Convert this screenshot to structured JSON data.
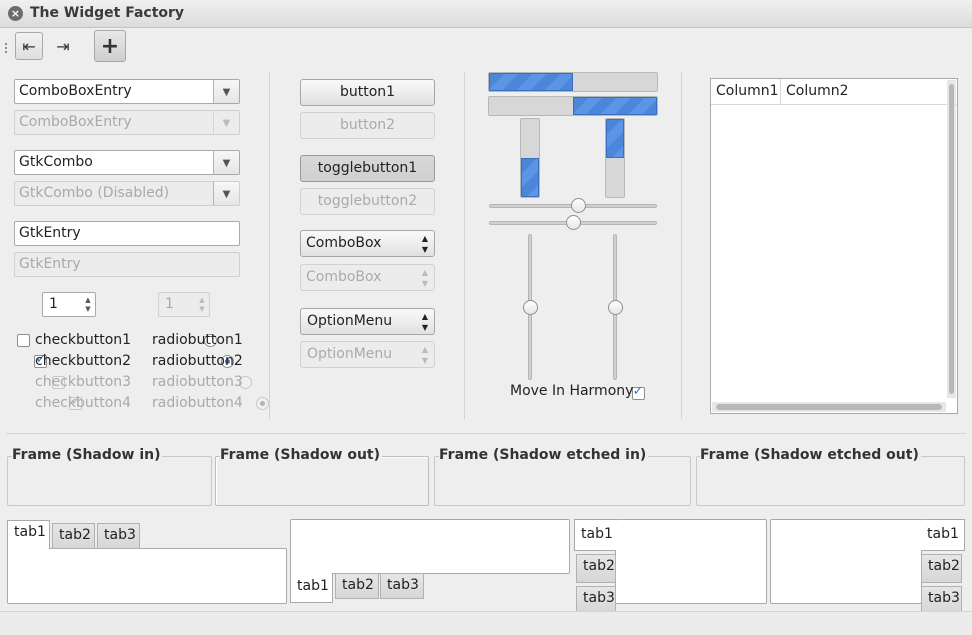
{
  "window": {
    "title": "The Widget Factory"
  },
  "toolbar": {
    "buttons": [
      {
        "icon": "go-first-icon",
        "glyph": "⇤"
      },
      {
        "icon": "go-last-icon",
        "glyph": "⇥"
      },
      {
        "icon": "add-icon",
        "glyph": "+"
      }
    ]
  },
  "col1": {
    "combobox_entry": "ComboBoxEntry",
    "combobox_entry_disabled": "ComboBoxEntry",
    "gtkcombo": "GtkCombo",
    "gtkcombo_disabled": "GtkCombo (Disabled)",
    "entry": "GtkEntry",
    "entry_disabled": "GtkEntry",
    "spin_value": "1",
    "spin_disabled_value": "1",
    "checks": [
      "checkbutton1",
      "checkbutton2",
      "checkbutton3",
      "checkbutton4"
    ],
    "radios": [
      "radiobutton1",
      "radiobutton2",
      "radiobutton3",
      "radiobutton4"
    ]
  },
  "col2": {
    "button1": "button1",
    "button2": "button2",
    "toggle1": "togglebutton1",
    "toggle2": "togglebutton2",
    "combobox": "ComboBox",
    "combobox_disabled": "ComboBox",
    "optionmenu": "OptionMenu",
    "optionmenu_disabled": "OptionMenu"
  },
  "col3": {
    "progress_h1": 0.5,
    "progress_h2": 0.5,
    "progress_v1": 0.5,
    "progress_v2": 0.5,
    "hscale1": 0.5,
    "hscale2": 0.5,
    "vscale1": 0.5,
    "vscale2": 0.5,
    "move_in_harmony": "Move In Harmony"
  },
  "tree": {
    "columns": [
      "Column1",
      "Column2"
    ]
  },
  "frames": [
    "Frame (Shadow in)",
    "Frame (Shadow out)",
    "Frame (Shadow etched in)",
    "Frame (Shadow etched out)"
  ],
  "notebooks": {
    "tabs": [
      "tab1",
      "tab2",
      "tab3"
    ]
  },
  "colors": {
    "accent": "#4a86da"
  }
}
